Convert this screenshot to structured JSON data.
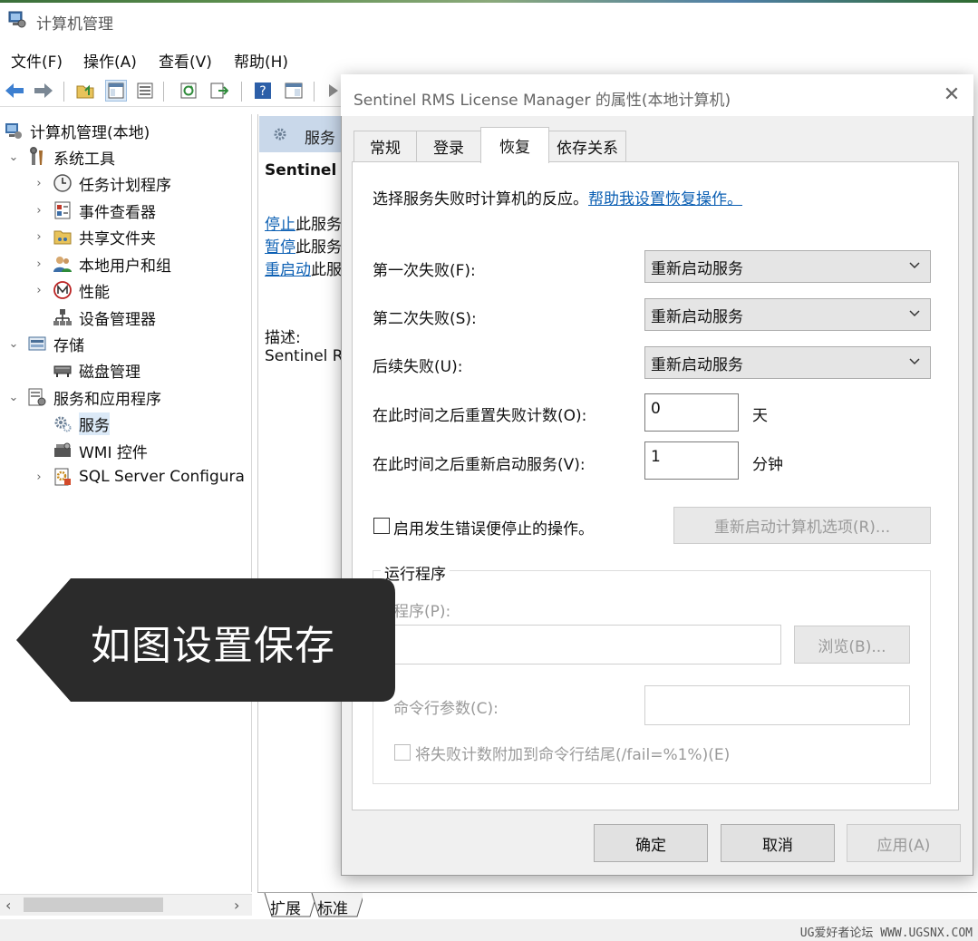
{
  "window": {
    "title": "计算机管理"
  },
  "menu": [
    "文件(F)",
    "操作(A)",
    "查看(V)",
    "帮助(H)"
  ],
  "toolbar": {
    "icons": [
      "back-arrow-icon",
      "forward-arrow-icon",
      "up-folder-icon",
      "console-tree-icon",
      "properties-icon",
      "refresh-icon",
      "export-icon",
      "help-icon",
      "toggle-pane-icon",
      "play-icon"
    ]
  },
  "tree": {
    "root": "计算机管理(本地)",
    "system_tools": "系统工具",
    "task_scheduler": "任务计划程序",
    "event_viewer": "事件查看器",
    "shared_folders": "共享文件夹",
    "local_users": "本地用户和组",
    "performance": "性能",
    "device_manager": "设备管理器",
    "storage": "存储",
    "disk_management": "磁盘管理",
    "services_apps": "服务和应用程序",
    "services": "服务",
    "wmi": "WMI 控件",
    "sql": "SQL Server Configura"
  },
  "middle": {
    "header": "服务",
    "service_name": "Sentinel I",
    "stop_link": "停止",
    "stop_rest": "此服务",
    "pause_link": "暂停",
    "pause_rest": "此服务",
    "restart_link": "重启动",
    "restart_rest": "此服",
    "desc_label": "描述:",
    "desc_value": "Sentinel R"
  },
  "bottom_tabs": {
    "extended": "扩展",
    "standard": "标准"
  },
  "watermark": "UG爱好者论坛 WWW.UGSNX.COM",
  "dialog": {
    "title": "Sentinel RMS License Manager 的属性(本地计算机)",
    "tabs": [
      "常规",
      "登录",
      "恢复",
      "依存关系"
    ],
    "active_tab": "恢复",
    "intro": "选择服务失败时计算机的反应。",
    "help_link": "帮助我设置恢复操作。",
    "first_failure_label": "第一次失败(F):",
    "first_failure_value": "重新启动服务",
    "second_failure_label": "第二次失败(S):",
    "second_failure_value": "重新启动服务",
    "subsequent_label": "后续失败(U):",
    "subsequent_value": "重新启动服务",
    "reset_label": "在此时间之后重置失败计数(O):",
    "reset_value": "0",
    "reset_unit": "天",
    "restart_label": "在此时间之后重新启动服务(V):",
    "restart_value": "1",
    "restart_unit": "分钟",
    "enable_actions_label": "启用发生错误便停止的操作。",
    "restart_computer_btn": "重新启动计算机选项(R)...",
    "run_program_group": "运行程序",
    "program_label": "程序(P):",
    "browse_btn": "浏览(B)...",
    "cmd_label": "命令行参数(C):",
    "append_label": "将失败计数附加到命令行结尾(/fail=%1%)(E)",
    "ok": "确定",
    "cancel": "取消",
    "apply": "应用(A)"
  },
  "callout": {
    "text": "如图设置保存"
  },
  "colors": {
    "link": "#0b5fb3",
    "selection": "#dbe9f7",
    "callout": "#2b2b2b"
  }
}
